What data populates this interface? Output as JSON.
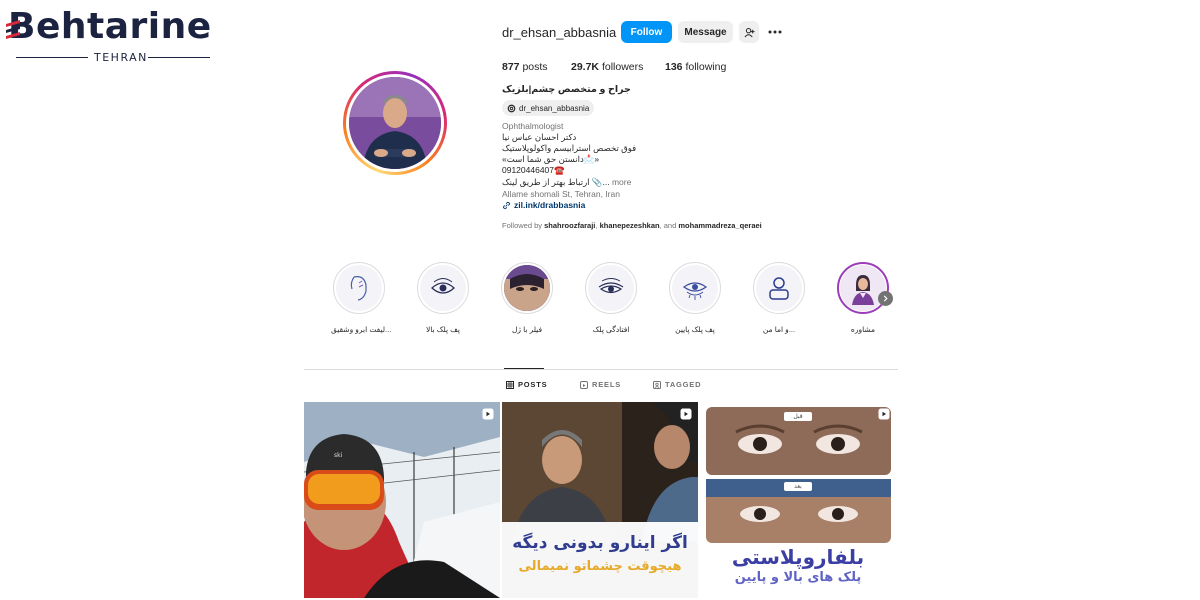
{
  "watermark": {
    "brand_rest": "ehtarine",
    "brand_first": "B",
    "city": "TEHRAN"
  },
  "profile": {
    "username": "dr_ehsan_abbasnia",
    "follow_label": "Follow",
    "message_label": "Message",
    "stats": {
      "posts_count": "877",
      "posts_label": "posts",
      "followers_count": "29.7K",
      "followers_label": "followers",
      "following_count": "136",
      "following_label": "following"
    },
    "name": "جراح و متخصص چشم|بلزیک",
    "threads_handle": "dr_ehsan_abbasnia",
    "category": "Ophthalmologist",
    "bio_lines": [
      "دکتر احسان عباس نیا",
      "فوق تخصص استرابیسم واکولوپلاستیک",
      "«دانستن حق شما است📩»",
      "09120446407☎️"
    ],
    "bio_last": "ارتباط بهتر از طریق لینک 📎...",
    "more_label": "more",
    "address": "Allame shomali St, Tehran, Iran",
    "link": "zil.ink/drabbasnia",
    "followed_by_prefix": "Followed by",
    "followed_by_1": "shahroozfaraji",
    "followed_by_2": "khanepezeshkan",
    "followed_by_and": ", and",
    "followed_by_3": "mohammadreza_qeraei"
  },
  "highlights": [
    {
      "label": "لیفت ابرو وشقیق...",
      "icon": "face-lift-icon"
    },
    {
      "label": "پف پلک بالا",
      "icon": "eye-lid-icon"
    },
    {
      "label": "فیلر با ژل",
      "icon": "portrait-photo"
    },
    {
      "label": "افتادگی پلک",
      "icon": "drooping-eye-icon"
    },
    {
      "label": "پف پلک پایین",
      "icon": "lower-lid-icon"
    },
    {
      "label": "و اما من...",
      "icon": "person-icon"
    },
    {
      "label": "مشاوره",
      "icon": "consultant-icon"
    }
  ],
  "tabs": {
    "posts": "POSTS",
    "reels": "REELS",
    "tagged": "TAGGED"
  },
  "posts": {
    "post2_line1": "اگر اینارو بدونی دیگه",
    "post2_line2": "هیچوقت چشماتو نمیمالی",
    "post3_before": "قبل",
    "post3_after": "بعد",
    "post3_line1": "بلفاروپلاستی",
    "post3_line2": "پلک های بالا و پایین"
  },
  "colors": {
    "follow_blue": "#0095f6",
    "link_blue": "#00376b",
    "brand_navy": "#1c2340",
    "brand_red": "#d62839"
  }
}
